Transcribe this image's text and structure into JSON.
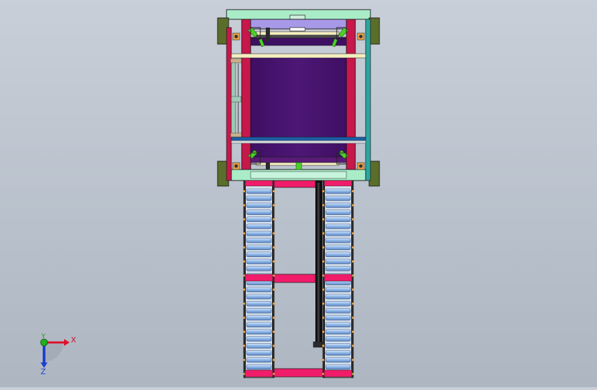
{
  "viewport": {
    "background_top": "#c9cfd8",
    "background_bottom": "#aeb6c2"
  },
  "triad": {
    "x_label": "X",
    "y_label": "Y",
    "z_label": "Z",
    "x_color": "#e0102a",
    "y_color": "#20b020",
    "z_color": "#2040d0"
  },
  "colors": {
    "purple_panel": "#4a1470",
    "violet_beam": "#a898e8",
    "crimson_post": "#c8174a",
    "teal_frame": "#2aa7a0",
    "mint_beam": "#a8ecc8",
    "olive_block": "#5a6e2a",
    "green_clip": "#4ccf2a",
    "roller_blue": "#8fb6e8",
    "pink_crossbar": "#f01c6a",
    "black_rail": "#101010"
  }
}
